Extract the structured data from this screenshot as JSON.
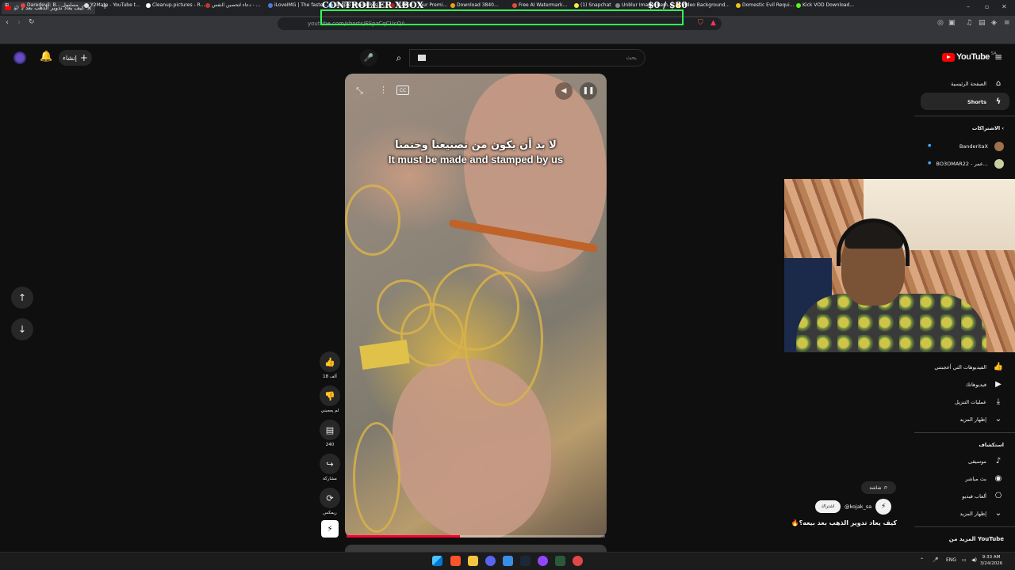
{
  "browser": {
    "tab_title": "كيف يعاد تدوير الذهب بعد بيعه؟",
    "url": "youtube.com/shorts/ESpzCqCUcQA",
    "bookmarks": [
      "Daredevil: B... مسلسل",
      "Y2Mate - YouTube t...",
      "Cleanup.pictures - R...",
      "دعاء لتحصين النفس - ...",
      "iLoveIMG | The faste...",
      "Simple Image Resiz...",
      "FLIXER - Your Premi...",
      "Download 3840...",
      "Free AI Watermark...",
      "(1) Snapchat",
      "Unblur Image: Rem...",
      "Video Background...",
      "Domestic Evil Requi...",
      "Kick VOD Download..."
    ]
  },
  "overlay": {
    "title": "CONTROLLER XBOX",
    "amount": "$0 / $80",
    "accent": "#33ff55"
  },
  "header": {
    "create_label": "إنشاء",
    "search_placeholder": "بحث",
    "logo_text": "YouTube",
    "logo_region": "SA"
  },
  "video": {
    "subtitle_ar": "لا بد أن يكون من تصنيعنا وختمنا",
    "subtitle_en": "It must be made and stamped by us",
    "cc_label": "CC",
    "progress": 0.44,
    "progress_color": "#ff0033"
  },
  "actions": [
    {
      "icon": "like-icon",
      "label": "18 ألف"
    },
    {
      "icon": "dislike-icon",
      "label": "لم يعجبني"
    },
    {
      "icon": "comment-icon",
      "label": "240"
    },
    {
      "icon": "share-icon",
      "label": "مشاركة"
    },
    {
      "icon": "remix-icon",
      "label": "ريمكس"
    }
  ],
  "sidebar": {
    "home": "الصفحة الرئيسية",
    "shorts": "Shorts",
    "subscriptions": "الاشتراكات",
    "subs": [
      "BanderitaX",
      "BO3OMAR22 - عمر..."
    ],
    "liked": "الفيديوهات التي أعجبتني",
    "your_videos": "فيديوهاتك",
    "downloads": "عمليات التنزيل",
    "show_more_1": "إظهار المزيد",
    "explore": "استكشاف",
    "music": "موسيقى",
    "live": "بث مباشر",
    "gaming": "ألعاب فيديو",
    "show_more_2": "إظهار المزيد",
    "more_from": "المزيد من YouTube"
  },
  "channel": {
    "search_label": "شاشة",
    "subscribe": "اشتراك",
    "handle": "@kojak_sa",
    "title": "كيف يعاد تدوير الذهب بعد بيعه؟🔥"
  },
  "taskbar": {
    "lang": "ENG",
    "time": "9:33 AM",
    "date": "3/24/2026"
  }
}
